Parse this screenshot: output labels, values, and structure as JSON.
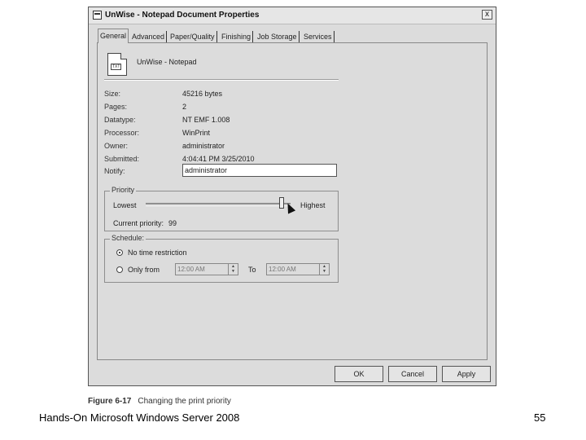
{
  "window": {
    "title": "UnWise - Notepad Document Properties",
    "close_label": "x"
  },
  "tabs": [
    {
      "label": "General",
      "active": true
    },
    {
      "label": "Advanced",
      "active": false
    },
    {
      "label": "Paper/Quality",
      "active": false
    },
    {
      "label": "Finishing",
      "active": false
    },
    {
      "label": "Job Storage",
      "active": false
    },
    {
      "label": "Services",
      "active": false
    }
  ],
  "document": {
    "name": "UnWise - Notepad",
    "icon_label": "TXT"
  },
  "properties": [
    {
      "label": "Size:",
      "value": "45216 bytes"
    },
    {
      "label": "Pages:",
      "value": "2"
    },
    {
      "label": "Datatype:",
      "value": "NT EMF 1.008"
    },
    {
      "label": "Processor:",
      "value": "WinPrint"
    },
    {
      "label": "Owner:",
      "value": "administrator"
    },
    {
      "label": "Submitted:",
      "value": "4:04:41 PM  3/25/2010"
    }
  ],
  "notify": {
    "label": "Notify:",
    "value": "administrator"
  },
  "priority": {
    "title": "Priority",
    "lowest_label": "Lowest",
    "highest_label": "Highest",
    "current_label": "Current priority:",
    "current_value": "99",
    "level": 99
  },
  "schedule": {
    "title": "Schedule:",
    "no_restriction_label": "No time restriction",
    "only_from_label": "Only from",
    "from_time": "12:00 AM",
    "to_label": "To",
    "to_time": "12:00 AM",
    "selected": "no_restriction"
  },
  "buttons": {
    "ok": "OK",
    "cancel": "Cancel",
    "apply": "Apply"
  },
  "caption": {
    "figure": "Figure 6-17",
    "text": "Changing the print priority"
  },
  "footer": {
    "book": "Hands-On Microsoft Windows Server 2008",
    "page": "55"
  }
}
